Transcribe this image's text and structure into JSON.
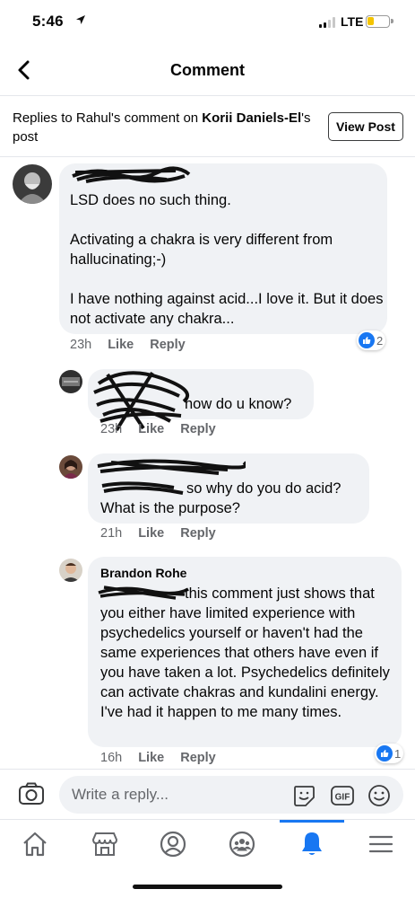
{
  "status_bar": {
    "time": "5:46",
    "network": "LTE"
  },
  "nav": {
    "title": "Comment"
  },
  "replies_header": {
    "prefix": "Replies to Rahul's comment on ",
    "post_owner": "Korii Daniels-El",
    "suffix": "'s post",
    "view_post_label": "View Post"
  },
  "comments": [
    {
      "body": "LSD does no such thing.\n\nActivating a chakra is very different from hallucinating;-)\n\nI have nothing against acid...I love it. But it does not activate any chakra...",
      "time": "23h",
      "like": "Like",
      "reply": "Reply",
      "reactions": "2"
    },
    {
      "body": "how do u know?",
      "time": "23h",
      "like": "Like",
      "reply": "Reply"
    },
    {
      "body": "so why do you do acid?\nWhat is the purpose?",
      "time": "21h",
      "like": "Like",
      "reply": "Reply"
    },
    {
      "name": "Brandon Rohe",
      "body": "this comment just shows that you either have limited experience with psychedelics yourself or haven't had the same experiences that others have even if you have taken a lot. Psychedelics definitely can activate chakras and kundalini energy. I've had it happen to me many times.",
      "time": "16h",
      "like": "Like",
      "reply": "Reply",
      "reactions": "1"
    }
  ],
  "composer": {
    "placeholder": "Write a reply..."
  },
  "colors": {
    "accent": "#1877f2",
    "bubble": "#f0f2f5",
    "meta": "#65676b"
  }
}
